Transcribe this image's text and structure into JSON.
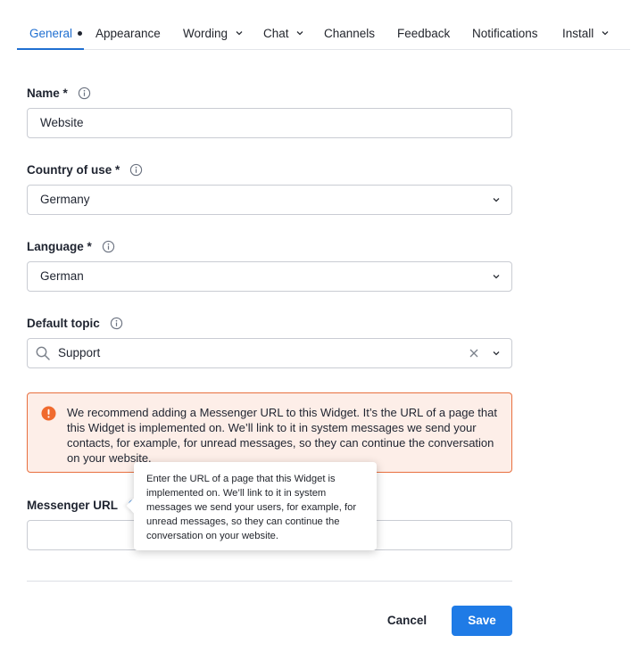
{
  "tabs": [
    {
      "label": "General",
      "active": true,
      "dirty_dot": true
    },
    {
      "label": "Appearance"
    },
    {
      "label": "Wording",
      "has_dropdown": true
    },
    {
      "label": "Chat",
      "has_dropdown": true
    },
    {
      "label": "Channels"
    },
    {
      "label": "Feedback"
    },
    {
      "label": "Notifications"
    },
    {
      "label": "Install",
      "has_dropdown": true
    }
  ],
  "form": {
    "name": {
      "label": "Name *",
      "value": "Website"
    },
    "country": {
      "label": "Country of use *",
      "value": "Germany"
    },
    "language": {
      "label": "Language *",
      "value": "German"
    },
    "topic": {
      "label": "Default topic",
      "value": "Support"
    },
    "messenger_url": {
      "label": "Messenger URL",
      "value": ""
    }
  },
  "alert": {
    "text": "We recommend adding a Messenger URL to this Widget. It’s the URL of a page that this Widget is implemented on. We’ll link to it in system messages we send your contacts, for example, for unread messages, so they can continue the conversation on your website."
  },
  "tooltip": {
    "text": "Enter the URL of a page that this Widget is implemented on. We’ll link to it in system messages we send your users, for example, for unread messages, so they can continue the conversation on your website."
  },
  "footer": {
    "cancel_label": "Cancel",
    "save_label": "Save"
  },
  "colors": {
    "accent": "#1f7be6",
    "tab_active": "#1f6fd1",
    "alert_border": "#e8703f",
    "alert_bg": "#fdeee8"
  }
}
